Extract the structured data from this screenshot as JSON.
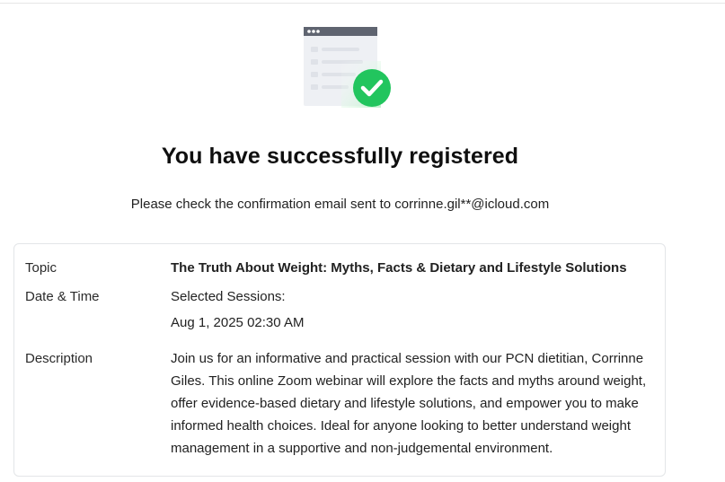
{
  "header": {
    "title": "You have successfully registered",
    "confirmation_text": "Please check the confirmation email sent to corrinne.gil**@icloud.com"
  },
  "illustration": {
    "icon": "browser-window-with-check-icon",
    "accent": "#22c55e"
  },
  "details": {
    "topic_label": "Topic",
    "topic_value": "The Truth About Weight: Myths, Facts & Dietary and Lifestyle Solutions",
    "datetime_label": "Date & Time",
    "sessions_label": "Selected Sessions:",
    "session_value": "Aug 1, 2025 02:30 AM",
    "description_label": "Description",
    "description_value": "Join us for an informative and practical session with our PCN dietitian, Corrinne Giles. This online Zoom webinar will explore the facts and myths around weight, offer evidence-based dietary and lifestyle solutions, and empower you to make informed health choices. Ideal for anyone looking to better understand weight management in a supportive and non-judgemental environment."
  }
}
